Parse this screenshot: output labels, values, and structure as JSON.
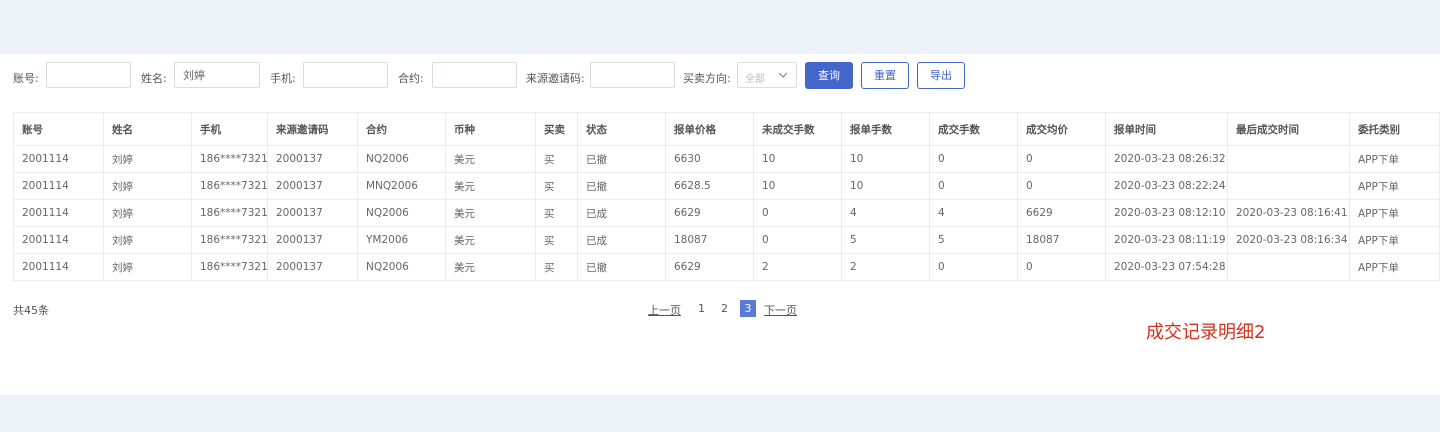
{
  "filters": {
    "account_label": "账号:",
    "account_value": "",
    "name_label": "姓名:",
    "name_value": "刘婷",
    "phone_label": "手机:",
    "phone_value": "",
    "contract_label": "合约:",
    "contract_value": "",
    "invite_label": "来源邀请码:",
    "invite_value": "",
    "direction_label": "买卖方向:",
    "direction_value": "全部",
    "query_button": "查询",
    "reset_button": "重置",
    "export_button": "导出"
  },
  "table": {
    "columns": [
      "账号",
      "姓名",
      "手机",
      "来源邀请码",
      "合约",
      "币种",
      "买卖",
      "状态",
      "报单价格",
      "未成交手数",
      "报单手数",
      "成交手数",
      "成交均价",
      "报单时间",
      "最后成交时间",
      "委托类别"
    ],
    "rows": [
      [
        "2001114",
        "刘婷",
        "186****7321",
        "2000137",
        "NQ2006",
        "美元",
        "买",
        "已撤",
        "6630",
        "10",
        "10",
        "0",
        "0",
        "2020-03-23 08:26:32",
        "",
        "APP下单"
      ],
      [
        "2001114",
        "刘婷",
        "186****7321",
        "2000137",
        "MNQ2006",
        "美元",
        "买",
        "已撤",
        "6628.5",
        "10",
        "10",
        "0",
        "0",
        "2020-03-23 08:22:24",
        "",
        "APP下单"
      ],
      [
        "2001114",
        "刘婷",
        "186****7321",
        "2000137",
        "NQ2006",
        "美元",
        "买",
        "已成",
        "6629",
        "0",
        "4",
        "4",
        "6629",
        "2020-03-23 08:12:10",
        "2020-03-23 08:16:41",
        "APP下单"
      ],
      [
        "2001114",
        "刘婷",
        "186****7321",
        "2000137",
        "YM2006",
        "美元",
        "买",
        "已成",
        "18087",
        "0",
        "5",
        "5",
        "18087",
        "2020-03-23 08:11:19",
        "2020-03-23 08:16:34",
        "APP下单"
      ],
      [
        "2001114",
        "刘婷",
        "186****7321",
        "2000137",
        "NQ2006",
        "美元",
        "买",
        "已撤",
        "6629",
        "2",
        "2",
        "0",
        "0",
        "2020-03-23 07:54:28",
        "",
        "APP下单"
      ]
    ]
  },
  "pagination": {
    "total": "共45条",
    "prev": "上一页",
    "pages": [
      "1",
      "2",
      "3"
    ],
    "current": "3",
    "next": "下一页"
  },
  "caption": "成交记录明细2",
  "colors": {
    "primary": "#4266c9",
    "page_current": "#5b7bd5",
    "caption": "#d0321e",
    "background": "#eef2f9"
  }
}
